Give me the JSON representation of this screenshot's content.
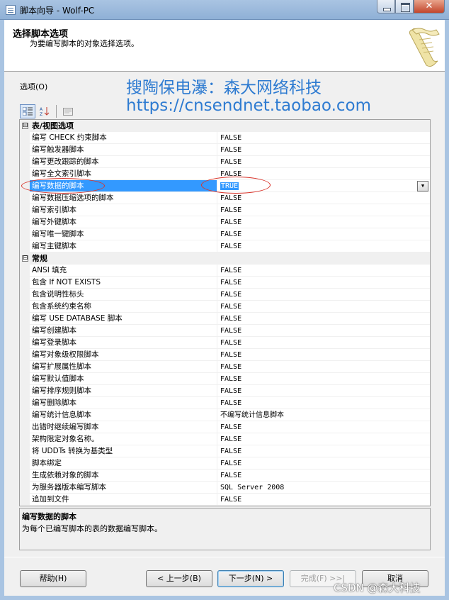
{
  "window": {
    "title": "脚本向导 - Wolf-PC",
    "close_glyph": "✕"
  },
  "header": {
    "title": "选择脚本选项",
    "subtitle": "为要编写脚本的对象选择选项。"
  },
  "options_label": "选项(O)",
  "watermark": {
    "line1": "搜陶保电瀑：森大网络科技",
    "line2": "https://cnsendnet.taobao.com"
  },
  "toolbar": {
    "categorized_icon": "categorized-icon",
    "alphabetical_icon": "alphabetical-icon",
    "property_pages_icon": "property-pages-icon"
  },
  "grid": {
    "categories": [
      {
        "label": "表/视图选项",
        "toggle": "⊟",
        "rows": [
          {
            "name": "编写 CHECK 约束脚本",
            "value": "FALSE"
          },
          {
            "name": "编写触发器脚本",
            "value": "FALSE"
          },
          {
            "name": "编写更改跟踪的脚本",
            "value": "FALSE"
          },
          {
            "name": "编写全文索引脚本",
            "value": "FALSE"
          },
          {
            "name": "编写数据的脚本",
            "value": "TRUE"
          },
          {
            "name": "编写数据压缩选项的脚本",
            "value": "FALSE"
          },
          {
            "name": "编写索引脚本",
            "value": "FALSE"
          },
          {
            "name": "编写外键脚本",
            "value": "FALSE"
          },
          {
            "name": "编写唯一键脚本",
            "value": "FALSE"
          },
          {
            "name": "编写主键脚本",
            "value": "FALSE"
          }
        ]
      },
      {
        "label": "常规",
        "toggle": "⊟",
        "rows": [
          {
            "name": "ANSI 填充",
            "value": "FALSE"
          },
          {
            "name": "包含 If NOT EXISTS",
            "value": "FALSE"
          },
          {
            "name": "包含说明性标头",
            "value": "FALSE"
          },
          {
            "name": "包含系统约束名称",
            "value": "FALSE"
          },
          {
            "name": "编写 USE DATABASE 脚本",
            "value": "FALSE"
          },
          {
            "name": "编写创建脚本",
            "value": "FALSE"
          },
          {
            "name": "编写登录脚本",
            "value": "FALSE"
          },
          {
            "name": "编写对象级权限脚本",
            "value": "FALSE"
          },
          {
            "name": "编写扩展属性脚本",
            "value": "FALSE"
          },
          {
            "name": "编写默认值脚本",
            "value": "FALSE"
          },
          {
            "name": "编写排序规则脚本",
            "value": "FALSE"
          },
          {
            "name": "编写删除脚本",
            "value": "FALSE"
          },
          {
            "name": "编写统计信息脚本",
            "value": "不编写统计信息脚本"
          },
          {
            "name": "出错时继续编写脚本",
            "value": "FALSE"
          },
          {
            "name": "架构限定对象名称。",
            "value": "FALSE"
          },
          {
            "name": "将 UDDTs 转换为基类型",
            "value": "FALSE"
          },
          {
            "name": "脚本绑定",
            "value": "FALSE"
          },
          {
            "name": "生成依赖对象的脚本",
            "value": "FALSE"
          },
          {
            "name": "为服务器版本编写脚本",
            "value": "SQL Server 2008"
          },
          {
            "name": "追加到文件",
            "value": "FALSE"
          }
        ]
      }
    ],
    "selected_row": "编写数据的脚本",
    "dropdown_glyph": "▼"
  },
  "description": {
    "title": "编写数据的脚本",
    "text": "为每个已编写脚本的表的数据编写脚本。"
  },
  "buttons": {
    "help": "帮助(H)",
    "back": "< 上一步(B)",
    "next": "下一步(N) >",
    "finish": "完成(F) >>|",
    "cancel": "取消"
  },
  "csdn_watermark": "CSDN @森大科技",
  "colors": {
    "selection": "#3399ff",
    "annotation_ellipse": "#d9342b",
    "watermark_text": "#2e7bd1"
  }
}
